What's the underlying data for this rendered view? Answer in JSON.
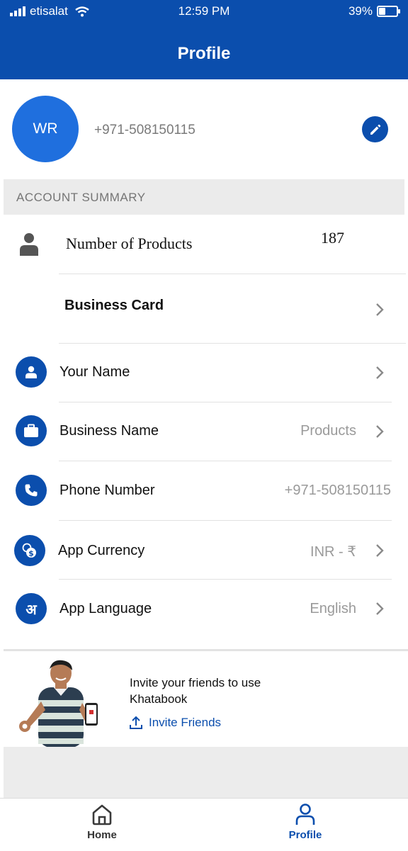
{
  "status_bar": {
    "carrier": "etisalat",
    "time": "12:59 PM",
    "battery": "39%",
    "battery_level": 0.39
  },
  "header": {
    "title": "Profile"
  },
  "profile": {
    "initials": "WR",
    "phone": "+971-508150115"
  },
  "account_summary": {
    "title": "ACCOUNT SUMMARY",
    "products_label": "Number of Products",
    "products_count": "187",
    "business_card_label": "Business Card"
  },
  "rows": [
    {
      "label": "Your Name",
      "value": "",
      "icon": "person-icon"
    },
    {
      "label": "Business Name",
      "value": "Products",
      "icon": "briefcase-icon"
    },
    {
      "label": "Phone Number",
      "value": "+971-508150115",
      "icon": "phone-icon"
    },
    {
      "label": "App Currency",
      "value": "INR - ₹",
      "icon": "currency-icon"
    },
    {
      "label": "App Language",
      "value": "English",
      "icon": "language-icon",
      "glyph": "अ"
    }
  ],
  "invite": {
    "text": "Invite your friends to use Khatabook",
    "link_label": "Invite Friends"
  },
  "tab_bar": {
    "home_label": "Home",
    "profile_label": "Profile"
  },
  "colors": {
    "primary": "#0b4ead",
    "avatar": "#1f6fde",
    "section_bg": "#ebebeb"
  }
}
